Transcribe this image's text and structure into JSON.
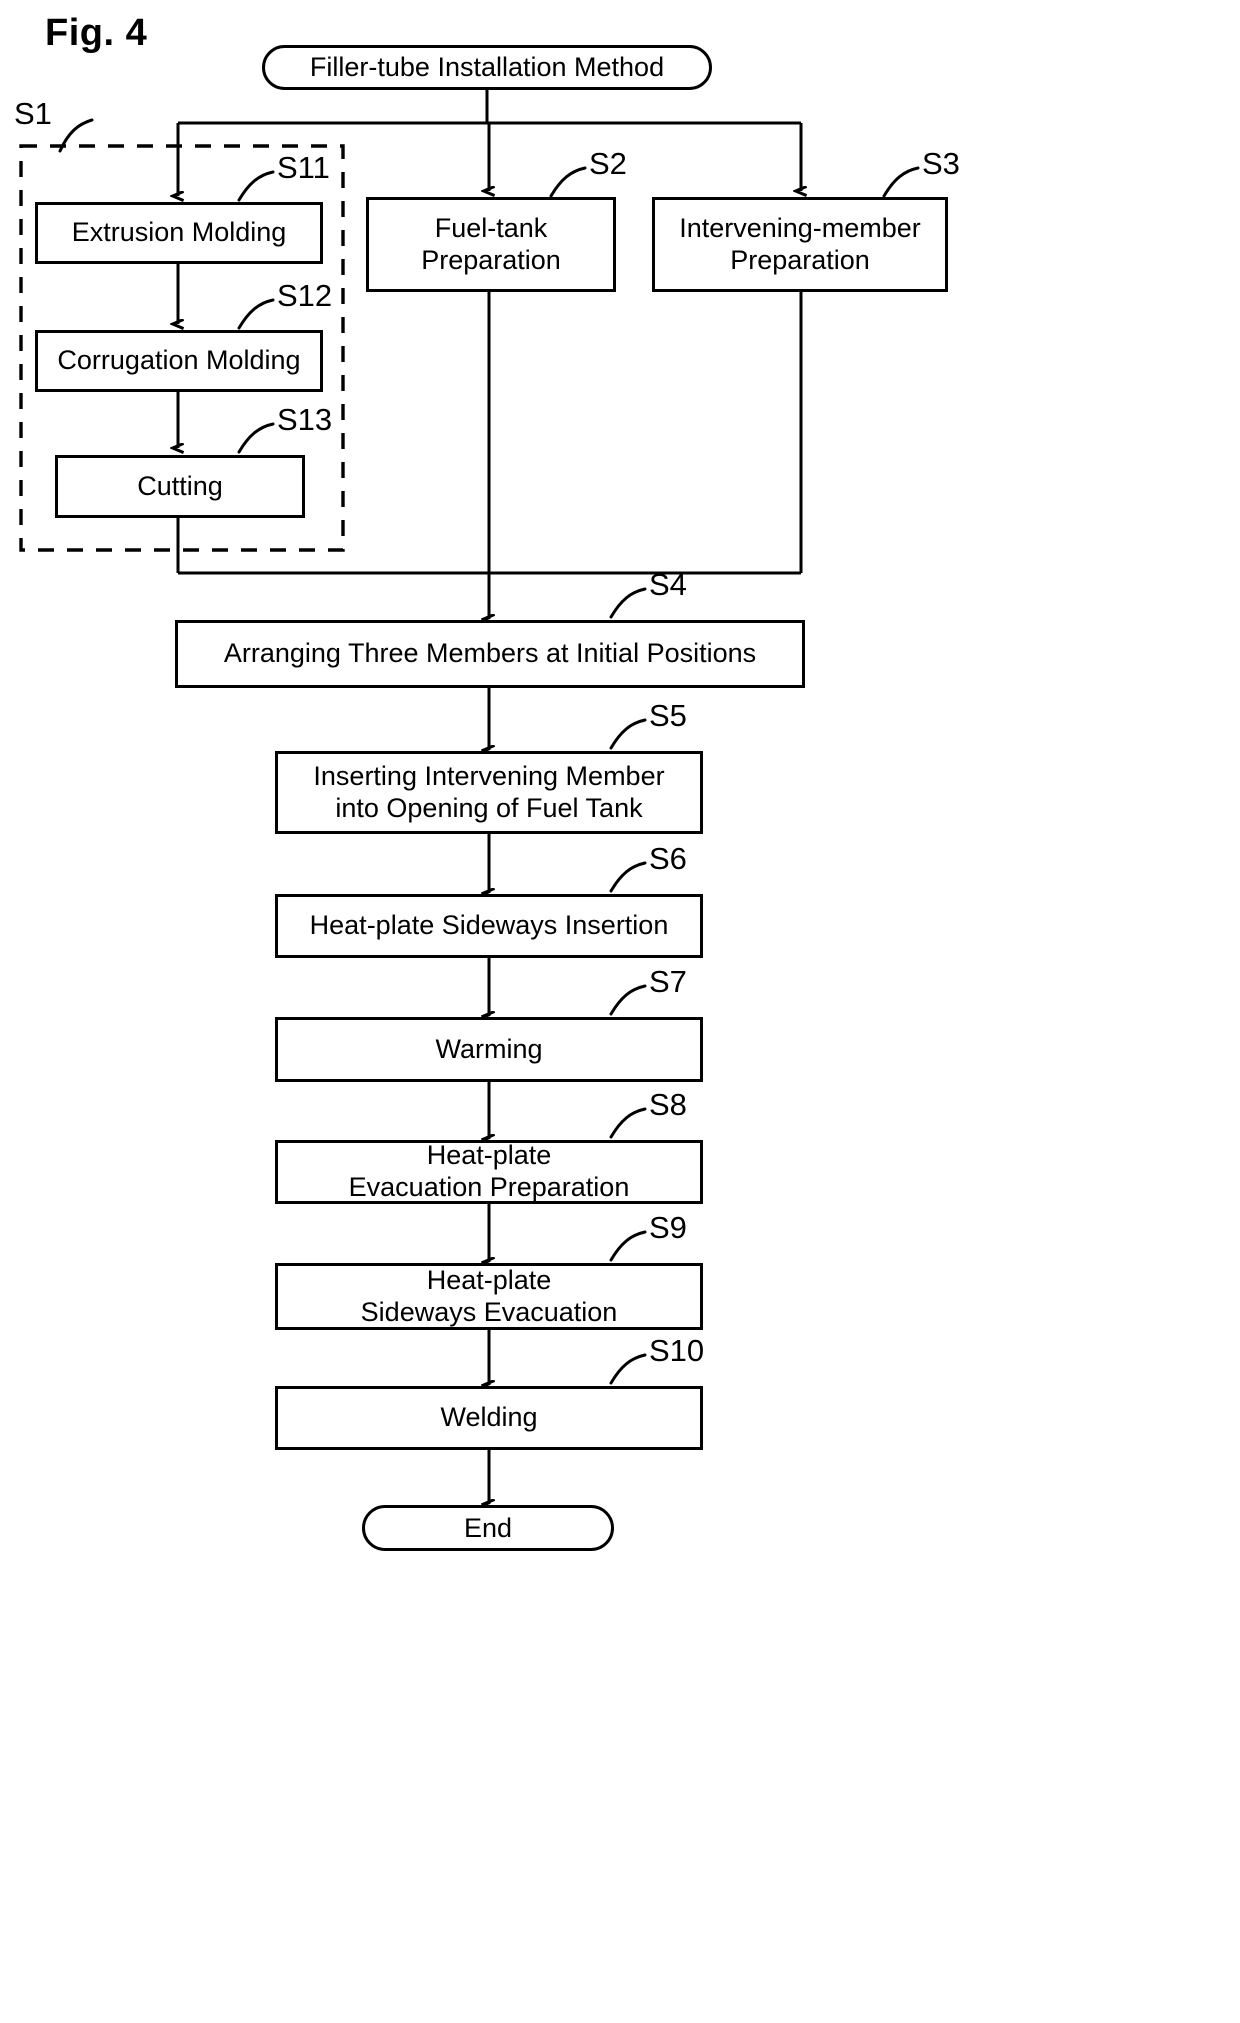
{
  "figure": {
    "label": "Fig. 4",
    "domain": "patent-flowchart"
  },
  "terminals": {
    "start": "Filler-tube Installation Method",
    "end": "End"
  },
  "group": {
    "ref": "S1",
    "style": "dashed"
  },
  "steps": [
    {
      "ref": "S11",
      "label": "Extrusion Molding"
    },
    {
      "ref": "S12",
      "label": "Corrugation Molding"
    },
    {
      "ref": "S13",
      "label": "Cutting"
    },
    {
      "ref": "S2",
      "label": "Fuel-tank\nPreparation"
    },
    {
      "ref": "S3",
      "label": "Intervening-member\nPreparation"
    },
    {
      "ref": "S4",
      "label": "Arranging Three Members at Initial Positions"
    },
    {
      "ref": "S5",
      "label": "Inserting Intervening Member\ninto Opening of Fuel Tank"
    },
    {
      "ref": "S6",
      "label": "Heat-plate Sideways Insertion"
    },
    {
      "ref": "S7",
      "label": "Warming"
    },
    {
      "ref": "S8",
      "label": "Heat-plate\nEvacuation Preparation"
    },
    {
      "ref": "S9",
      "label": "Heat-plate\nSideways Evacuation"
    },
    {
      "ref": "S10",
      "label": "Welding"
    }
  ],
  "colors": {
    "line": "#000000",
    "background": "#ffffff",
    "text": "#000000"
  }
}
